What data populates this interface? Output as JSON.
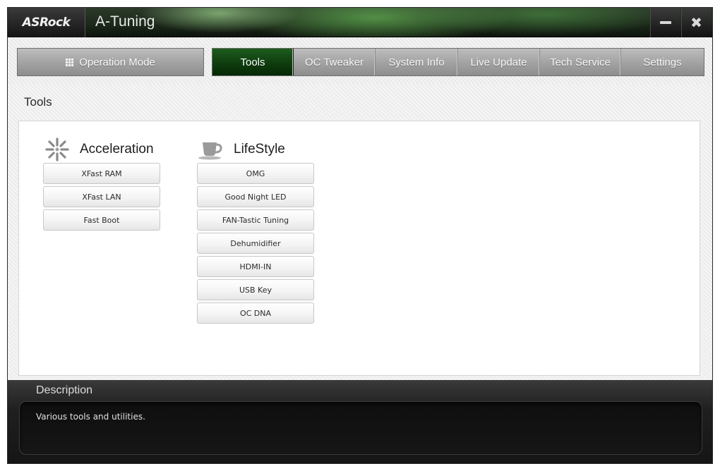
{
  "titlebar": {
    "logo": "ASRock",
    "app_title": "A-Tuning",
    "minimize_icon": "minimize-icon",
    "close_glyph": "✖"
  },
  "nav": {
    "operation_mode": "Operation Mode",
    "tabs": [
      {
        "label": "Tools",
        "active": true
      },
      {
        "label": "OC Tweaker",
        "active": false
      },
      {
        "label": "System Info",
        "active": false
      },
      {
        "label": "Live Update",
        "active": false
      },
      {
        "label": "Tech Service",
        "active": false
      },
      {
        "label": "Settings",
        "active": false
      }
    ]
  },
  "page": {
    "title": "Tools",
    "groups": [
      {
        "label": "Acceleration",
        "icon": "burst-icon",
        "items": [
          "XFast RAM",
          "XFast LAN",
          "Fast Boot"
        ]
      },
      {
        "label": "LifeStyle",
        "icon": "coffee-cup-icon",
        "items": [
          "OMG",
          "Good Night LED",
          "FAN-Tastic Tuning",
          "Dehumidifier",
          "HDMI-IN",
          "USB Key",
          "OC DNA"
        ]
      }
    ]
  },
  "description": {
    "title": "Description",
    "text": "Various tools and utilities."
  },
  "colors": {
    "active_tab": "#0f3d0f",
    "tab_inactive": "#a4a4a4",
    "description_bg": "#151515"
  }
}
